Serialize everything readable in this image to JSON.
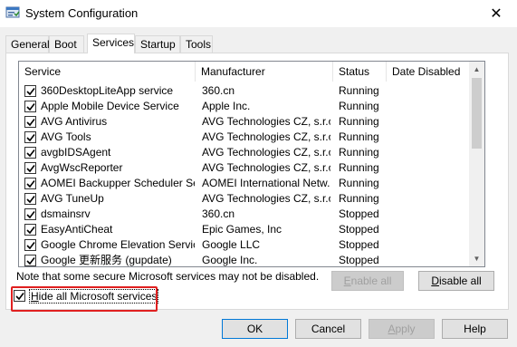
{
  "window": {
    "title": "System Configuration",
    "close_glyph": "✕"
  },
  "tabs": [
    {
      "label": "General"
    },
    {
      "label": "Boot"
    },
    {
      "label": "Services",
      "active": true
    },
    {
      "label": "Startup"
    },
    {
      "label": "Tools"
    }
  ],
  "services": {
    "columns": [
      "Service",
      "Manufacturer",
      "Status",
      "Date Disabled"
    ],
    "rows": [
      {
        "service": "360DesktopLiteApp service",
        "manufacturer": "360.cn",
        "status": "Running",
        "checked": true
      },
      {
        "service": "Apple Mobile Device Service",
        "manufacturer": "Apple Inc.",
        "status": "Running",
        "checked": true
      },
      {
        "service": "AVG Antivirus",
        "manufacturer": "AVG Technologies CZ, s.r.o.",
        "status": "Running",
        "checked": true
      },
      {
        "service": "AVG Tools",
        "manufacturer": "AVG Technologies CZ, s.r.o.",
        "status": "Running",
        "checked": true
      },
      {
        "service": "avgbIDSAgent",
        "manufacturer": "AVG Technologies CZ, s.r.o.",
        "status": "Running",
        "checked": true
      },
      {
        "service": "AvgWscReporter",
        "manufacturer": "AVG Technologies CZ, s.r.o.",
        "status": "Running",
        "checked": true
      },
      {
        "service": "AOMEI Backupper Scheduler Ser...",
        "manufacturer": "AOMEI International Netw...",
        "status": "Running",
        "checked": true
      },
      {
        "service": "AVG TuneUp",
        "manufacturer": "AVG Technologies CZ, s.r.o.",
        "status": "Running",
        "checked": true
      },
      {
        "service": "dsmainsrv",
        "manufacturer": "360.cn",
        "status": "Stopped",
        "checked": true
      },
      {
        "service": "EasyAntiCheat",
        "manufacturer": "Epic Games, Inc",
        "status": "Stopped",
        "checked": true
      },
      {
        "service": "Google Chrome Elevation Servic...",
        "manufacturer": "Google LLC",
        "status": "Stopped",
        "checked": true
      },
      {
        "service": "Google 更新服务 (gupdate)",
        "manufacturer": "Google Inc.",
        "status": "Stopped",
        "checked": true
      }
    ]
  },
  "note": "Note that some secure Microsoft services may not be disabled.",
  "enable_all": {
    "prefix": "",
    "mnemonic": "E",
    "rest": "nable all",
    "disabled": true
  },
  "disable_all": {
    "prefix": "",
    "mnemonic": "D",
    "rest": "isable all"
  },
  "hide_ms": {
    "prefix": "",
    "mnemonic": "H",
    "rest": "ide all Microsoft services",
    "checked": true
  },
  "footer": {
    "ok": "OK",
    "cancel": "Cancel",
    "apply": {
      "prefix": "",
      "mnemonic": "A",
      "rest": "pply",
      "disabled": true
    },
    "help": "Help"
  },
  "colors": {
    "highlight": "#e02020",
    "focus_border": "#0078d7"
  }
}
